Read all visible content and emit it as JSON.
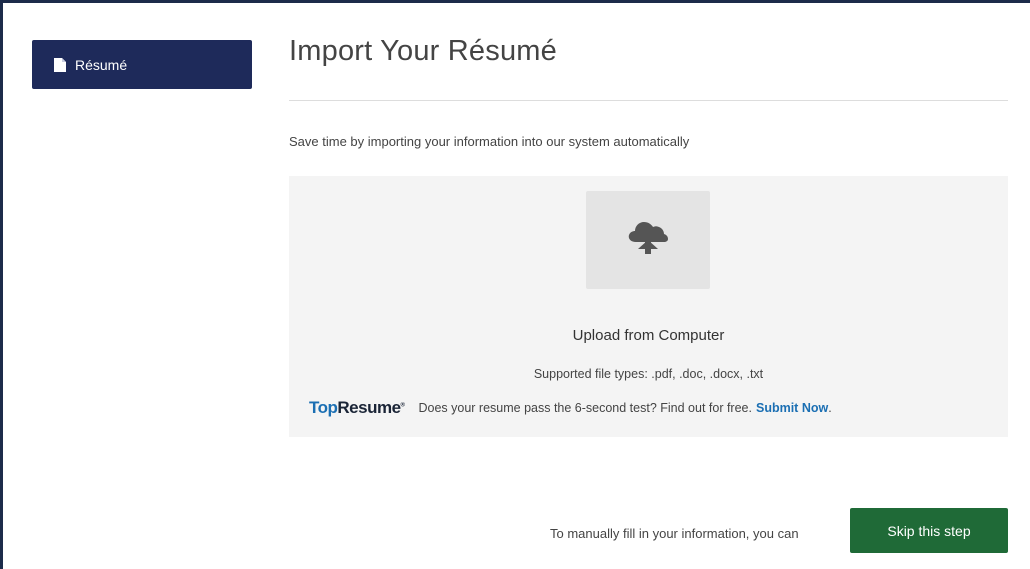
{
  "sidebar": {
    "items": [
      {
        "label": "Résumé",
        "icon": "document-icon",
        "active": true
      }
    ]
  },
  "main": {
    "title": "Import Your Résumé",
    "subtitle": "Save time by importing your information into our system automatically",
    "upload": {
      "icon": "cloud-upload-icon",
      "heading": "Upload from Computer",
      "supported_types": "Supported file types: .pdf, .doc, .docx, .txt"
    },
    "promo": {
      "logo_part1": "Top",
      "logo_part2": "Resume",
      "logo_mark": "®",
      "text": "Does your resume pass the 6-second test? Find out for free.",
      "link_label": "Submit Now",
      "trailing": "."
    }
  },
  "footer": {
    "manual_text": "To manually fill in your information, you can",
    "skip_label": "Skip this step"
  },
  "colors": {
    "sidebar_active": "#1e2a5a",
    "panel_bg": "#f4f4f4",
    "primary_button": "#1f6a37",
    "link": "#1b6fb3"
  }
}
